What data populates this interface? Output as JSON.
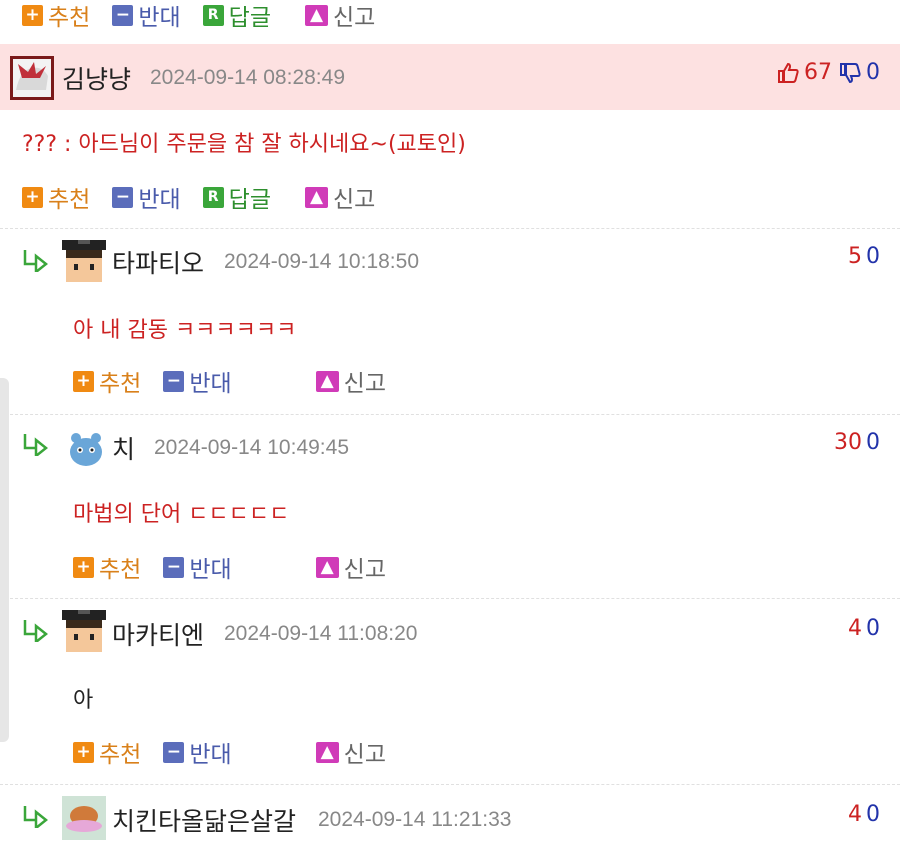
{
  "labels": {
    "recommend": "추천",
    "oppose": "반대",
    "reply": "답글",
    "report": "신고",
    "reply_icon": "R"
  },
  "main_comment": {
    "nickname": "김냥냥",
    "timestamp": "2024-09-14 08:28:49",
    "up": "67",
    "down": "0",
    "text": "??? : 아드님이 주문을 참 잘 하시네요~(교토인)"
  },
  "replies": [
    {
      "nickname": "타파티오",
      "timestamp": "2024-09-14 10:18:50",
      "up": "5",
      "down": "0",
      "text": "아 내 감동 ㅋㅋㅋㅋㅋㅋ"
    },
    {
      "nickname": "치",
      "timestamp": "2024-09-14 10:49:45",
      "up": "30",
      "down": "0",
      "text": "마법의 단어 ㄷㄷㄷㄷㄷ"
    },
    {
      "nickname": "마카티엔",
      "timestamp": "2024-09-14 11:08:20",
      "up": "4",
      "down": "0",
      "text": "아"
    },
    {
      "nickname": "치킨타올닮은살갈",
      "timestamp": "2024-09-14 11:21:33",
      "up": "4",
      "down": "0",
      "text": ""
    }
  ],
  "colors": {
    "header_bg": "#fde1e1",
    "text_red": "#cc2222",
    "recommend": "#f08a12",
    "oppose": "#5b6dbb",
    "reply": "#3aa63a",
    "report": "#d03bb8"
  }
}
